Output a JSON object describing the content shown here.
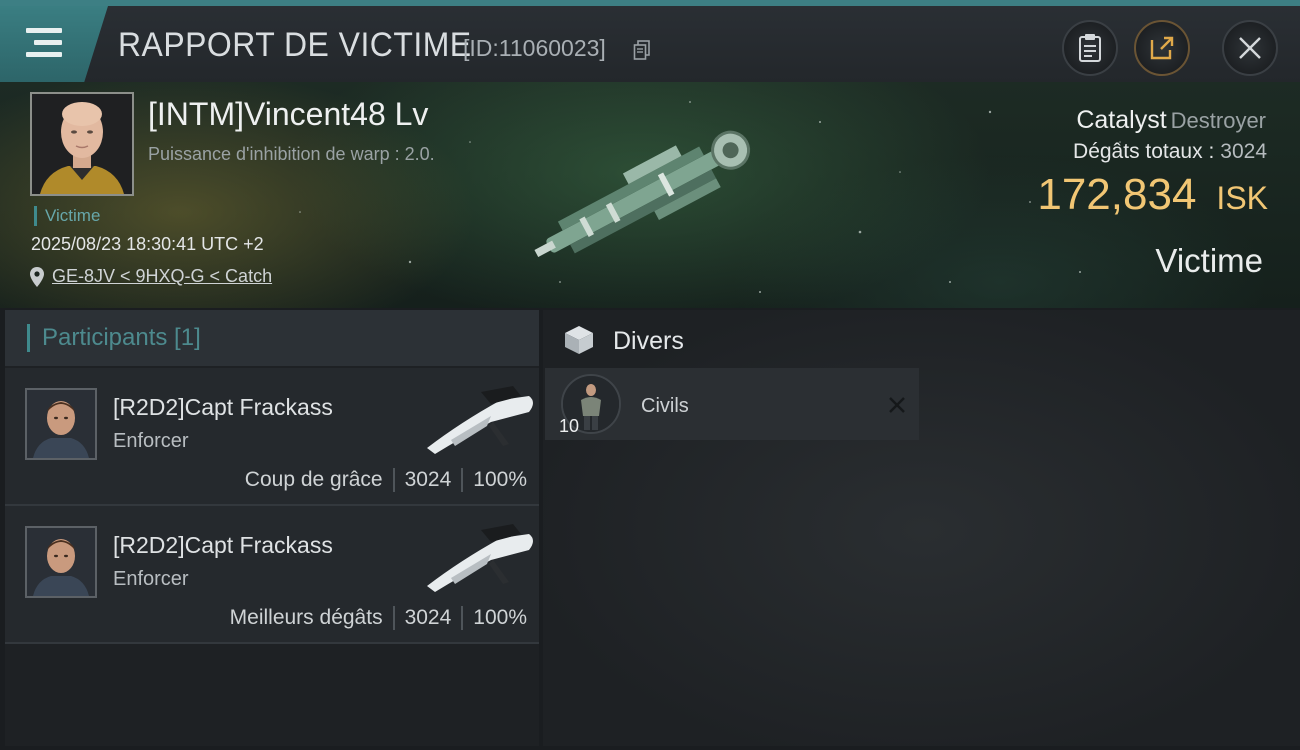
{
  "header": {
    "title": "RAPPORT DE VICTIME",
    "id_text": "[ID:11060023]",
    "icons": [
      "menu-icon",
      "copy-icon",
      "clipboard-icon",
      "share-icon",
      "close-icon"
    ]
  },
  "victim": {
    "name": "[INTM]Vincent48 Lv",
    "subtitle": "Puissance d'inhibition de warp : 2.0.",
    "tag": "Victime",
    "datetime": "2025/08/23 18:30:41 UTC +2",
    "location": "GE-8JV < 9HXQ-G < Catch",
    "ship_name": "Catalyst",
    "ship_class": "Destroyer",
    "damage_label": "Dégâts totaux :",
    "damage_value": "3024",
    "isk_value": "172,834",
    "isk_unit": "ISK",
    "role": "Victime"
  },
  "participants": {
    "header": "Participants [1]",
    "rows": [
      {
        "name": "[R2D2]Capt Frackass",
        "ship": "Enforcer",
        "label": "Coup de grâce",
        "damage": "3024",
        "percent": "100%"
      },
      {
        "name": "[R2D2]Capt Frackass",
        "ship": "Enforcer",
        "label": "Meilleurs dégâts",
        "damage": "3024",
        "percent": "100%"
      }
    ]
  },
  "divers": {
    "title": "Divers",
    "items": [
      {
        "quantity": "10",
        "name": "Civils"
      }
    ]
  },
  "colors": {
    "accent_teal": "#3d7f84",
    "isk_gold": "#f1c674",
    "panel_bg": "#1e2124"
  }
}
